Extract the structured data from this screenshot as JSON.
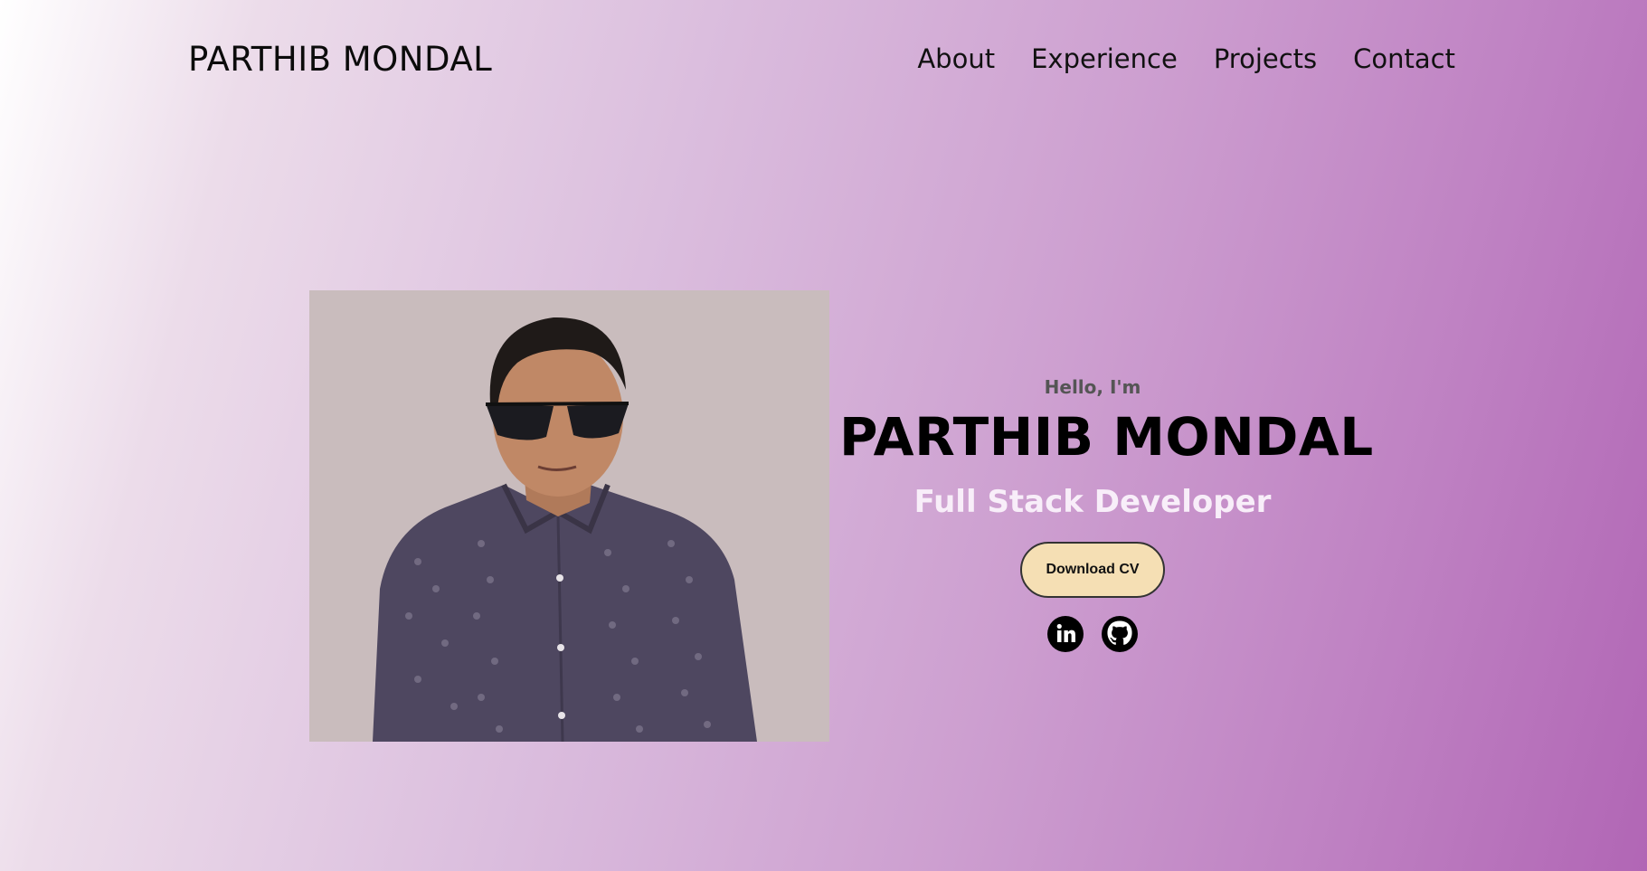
{
  "header": {
    "brand": "PARTHIB MONDAL",
    "nav": [
      {
        "label": "About"
      },
      {
        "label": "Experience"
      },
      {
        "label": "Projects"
      },
      {
        "label": "Contact"
      }
    ]
  },
  "hero": {
    "greeting": "Hello, I'm",
    "name": "PARTHIB MONDAL",
    "role": "Full Stack Developer",
    "download_label": "Download CV",
    "socials": [
      {
        "icon": "linkedin-icon"
      },
      {
        "icon": "github-icon"
      }
    ]
  },
  "colors": {
    "button_bg": "#f5dfb4",
    "role_text": "#f8eef9",
    "gradient_start": "#ffffff",
    "gradient_end": "#b166b5"
  }
}
